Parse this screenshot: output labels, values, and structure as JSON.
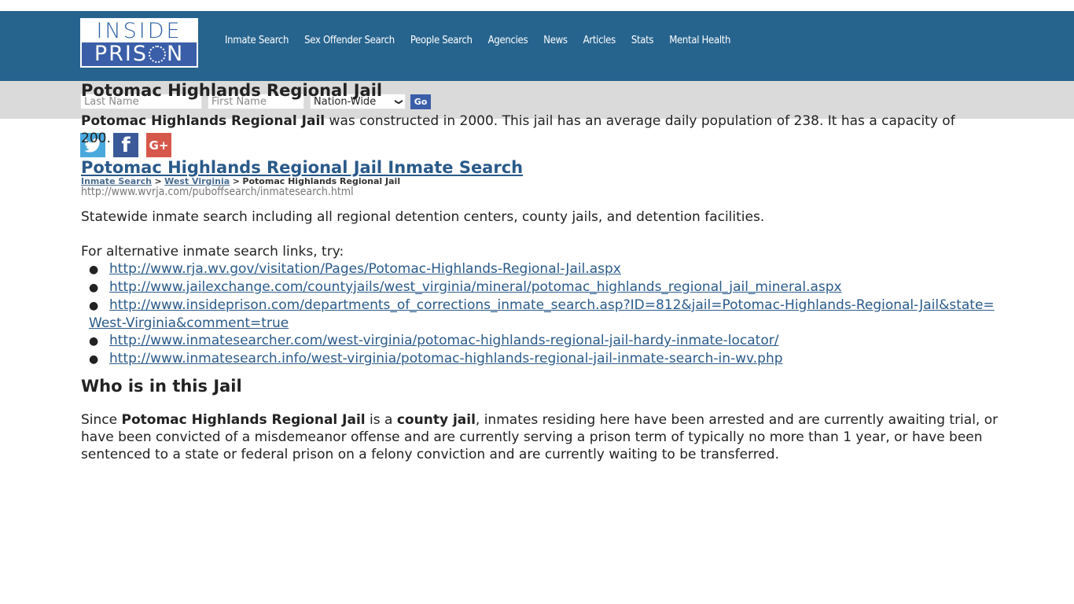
{
  "logo": {
    "top": "INSIDE",
    "bottom_left": "PRIS",
    "bottom_right": "N"
  },
  "nav": [
    "Inmate Search",
    "Sex Offender Search",
    "People Search",
    "Agencies",
    "News",
    "Articles",
    "Stats",
    "Mental Health"
  ],
  "search": {
    "last_name_placeholder": "Last Name",
    "first_name_placeholder": "First Name",
    "state_selected": "Nation-Wide",
    "go_label": "Go"
  },
  "social": {
    "twitter": "twitter-icon",
    "facebook": "f",
    "google": "G+"
  },
  "breadcrumb": {
    "items": [
      "Inmate Search",
      "West Virginia"
    ],
    "separator": ">",
    "current": "Potomac Highlands Regional Jail"
  },
  "page": {
    "title": "Potomac Highlands Regional Jail",
    "intro_bold": "Potomac Highlands Regional Jail",
    "intro_rest": " was constructed in 2000. This jail has an average daily population of 238. It has a capacity of 200.",
    "main_link": "Potomac Highlands Regional Jail Inmate Search",
    "main_url": "http://www.wvrja.com/puboffsearch/inmatesearch.html",
    "description": "Statewide inmate search including all regional detention centers, county jails, and detention facilities.",
    "alt_intro": "For alternative inmate search links, try:",
    "alt_links": [
      "http://www.rja.wv.gov/visitation/Pages/Potomac-Highlands-Regional-Jail.aspx",
      "http://www.jailexchange.com/countyjails/west_virginia/mineral/potomac_highlands_regional_jail_mineral.aspx",
      "http://www.insideprison.com/departments_of_corrections_inmate_search.asp?ID=812&jail=Potomac-Highlands-Regional-Jail&state=West-Virginia&comment=true",
      "http://www.inmatesearcher.com/west-virginia/potomac-highlands-regional-jail-hardy-inmate-locator/",
      "http://www.inmatesearch.info/west-virginia/potomac-highlands-regional-jail-inmate-search-in-wv.php"
    ],
    "who_heading": "Who is in this Jail",
    "who": {
      "p1": "Since ",
      "b1": "Potomac Highlands Regional Jail",
      "p2": " is a ",
      "b2": "county jail",
      "p3": ", inmates residing here have been arrested and are currently awaiting trial, or have been convicted of a misdemeanor offense and are currently serving a prison term of typically no more than 1 year, or have been sentenced to a state or federal prison on a felony conviction and are currently waiting to be transferred."
    }
  },
  "colors": {
    "header": "#26648e",
    "searchbar": "#dadada",
    "link": "#2a5a8a",
    "go_button": "#3a5ea8",
    "twitter": "#4aa9dc",
    "facebook": "#3b5998",
    "google": "#d6584b"
  }
}
